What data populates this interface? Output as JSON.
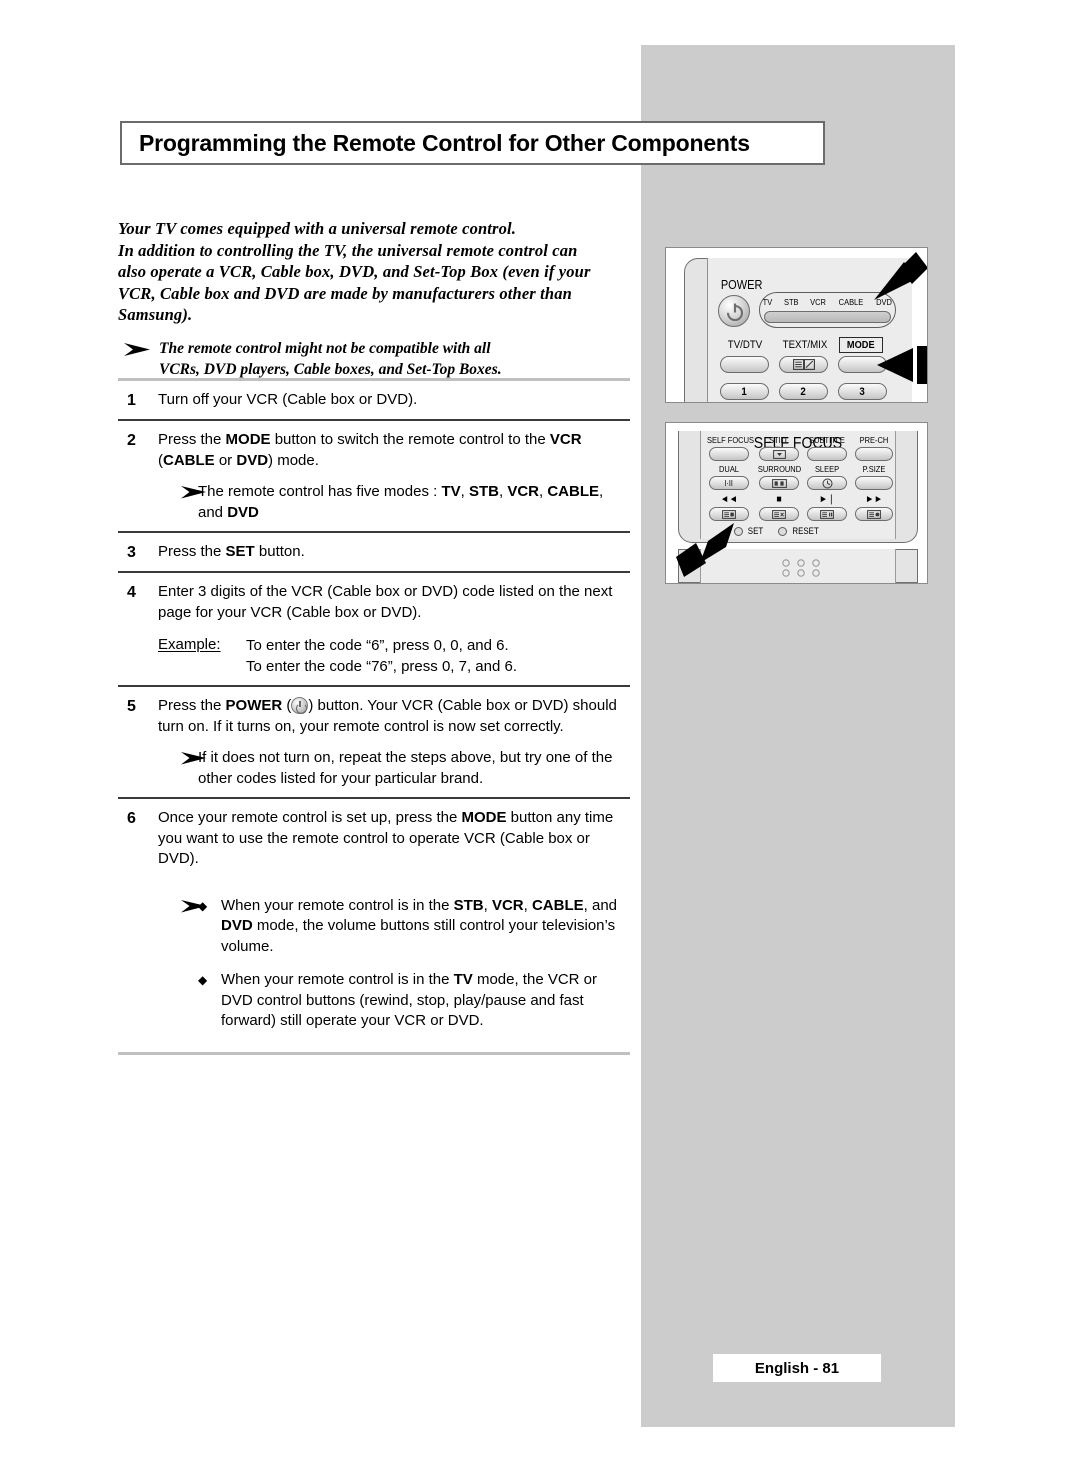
{
  "page": {
    "title": "Programming the Remote Control for Other Components",
    "footer": "English - 81"
  },
  "intro": {
    "lines": [
      "Your TV comes equipped with a universal remote control.",
      "In addition to controlling the TV, the universal remote control can",
      "also operate a VCR, Cable box, DVD, and Set-Top Box (even if your",
      "VCR, Cable box and DVD are made by manufacturers other than",
      "Samsung)."
    ],
    "note": [
      "The remote control might not be compatible with all",
      "VCRs, DVD players, Cable boxes, and Set-Top Boxes."
    ]
  },
  "steps": [
    {
      "num": "1",
      "text_html": "Turn off your VCR (Cable box or DVD)."
    },
    {
      "num": "2",
      "text_html": "Press the <b>MODE</b> button to switch the remote control to the <b>VCR</b> (<b>CABLE</b> or <b>DVD</b>) mode.",
      "note_html": "The remote control has five modes : <b>TV</b>, <b>STB</b>, <b>VCR</b>, <b>CABLE</b>, and <b>DVD</b>"
    },
    {
      "num": "3",
      "text_html": "Press the <b>SET</b> button."
    },
    {
      "num": "4",
      "text_html": "Enter 3 digits of the VCR (Cable box or DVD) code listed on the next page for your VCR (Cable box or DVD).",
      "example_label": "Example:",
      "example_lines": [
        "To enter the code “6”, press 0, 0, and 6.",
        "To enter the code “76”, press 0, 7, and 6."
      ]
    },
    {
      "num": "5",
      "text_html": "Press the <b>POWER</b> (<span class=\"pwr-inline\" data-name=\"power-button-icon\"></span>) button. Your VCR (Cable box or DVD) should turn on. If it turns on, your remote control is now set correctly.",
      "note_html": "If it does not turn on, repeat the steps above, but try one of the other codes listed for your particular brand."
    },
    {
      "num": "6",
      "text_html": "Once your remote control is set up, press the <b>MODE</b> button any time you want to use the remote control to operate VCR (Cable box or DVD).",
      "bullets": [
        "When your remote control is in the <b>STB</b>, <b>VCR</b>, <b>CABLE</b>, and <b>DVD</b> mode, the volume buttons still control your television’s volume.",
        "When your remote control is in the <b>TV</b> mode, the VCR or DVD control buttons (rewind, stop, play/pause and fast forward) still operate your VCR or DVD."
      ],
      "bullet_mark": "◆"
    }
  ],
  "illustration_top": {
    "power_label": "POWER",
    "mode_strip": [
      "TV",
      "STB",
      "VCR",
      "CABLE",
      "DVD"
    ],
    "row_labels": [
      "TV/DTV",
      "TEXT/MIX",
      "MODE"
    ],
    "number_buttons": [
      "1",
      "2",
      "3"
    ]
  },
  "illustration_bottom": {
    "row1_labels": [
      "SELF FOCUS",
      "STILL",
      "SUBTITLE",
      "PRE-CH"
    ],
    "row2_labels": [
      "DUAL",
      "SURROUND",
      "SLEEP",
      "P.SIZE"
    ],
    "transport_labels": [
      "◄◄",
      "■",
      "►❘",
      "►►"
    ],
    "set_label": "SET",
    "reset_label": "RESET",
    "dual_glyph": "I·II"
  },
  "colors": {
    "panel_gray": "#cccccc",
    "rule_light": "#c0c0c0",
    "rule_dark": "#3a3a3a"
  }
}
